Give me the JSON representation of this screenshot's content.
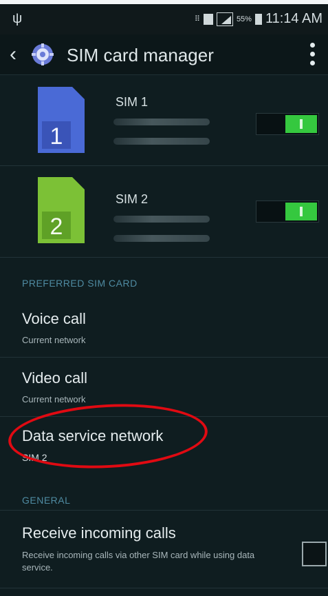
{
  "status_bar": {
    "time": "11:14 AM",
    "battery_text": "55%",
    "icons": [
      "usb-icon",
      "vibrate-icon",
      "sim-icon",
      "signal-icon",
      "battery-icon"
    ]
  },
  "app_bar": {
    "title": "SIM card manager",
    "icons": [
      "back-icon",
      "gear-icon",
      "overflow-menu-icon"
    ]
  },
  "sims": [
    {
      "label": "SIM 1",
      "number": "1",
      "color": "#4a6ad6",
      "enabled": true
    },
    {
      "label": "SIM 2",
      "number": "2",
      "color": "#7cc136",
      "enabled": true
    }
  ],
  "preferred_section_title": "PREFERRED SIM CARD",
  "preferred_items": [
    {
      "title": "Voice call",
      "subtitle": "Current network"
    },
    {
      "title": "Video call",
      "subtitle": "Current network"
    },
    {
      "title": "Data service network",
      "subtitle": "SIM 2"
    }
  ],
  "general_section_title": "GENERAL",
  "general_items": [
    {
      "title": "Receive incoming calls",
      "subtitle": "Receive incoming calls via other SIM card while using data service.",
      "checked": false
    }
  ],
  "colors": {
    "background": "#0f1d20",
    "toggle_on": "#35c83f",
    "section_title": "#4f8ba2",
    "annotation_circle": "#e00a12"
  }
}
